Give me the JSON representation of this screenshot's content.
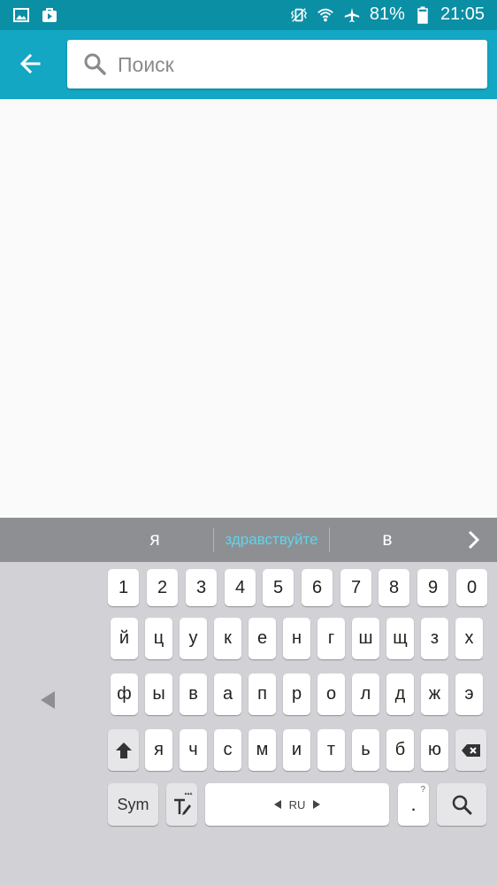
{
  "status_bar": {
    "icons_left": [
      "gallery-icon",
      "play-store-icon"
    ],
    "icons_right": [
      "vibrate-icon",
      "wifi-icon",
      "airplane-icon"
    ],
    "battery_text": "81%",
    "time": "21:05"
  },
  "toolbar": {
    "search_placeholder": "Поиск",
    "accent_color": "#13a7c4"
  },
  "suggestions": {
    "left": "я",
    "middle": "здравствуйте",
    "right": "в"
  },
  "keyboard": {
    "numbers": [
      "1",
      "2",
      "3",
      "4",
      "5",
      "6",
      "7",
      "8",
      "9",
      "0"
    ],
    "row1": [
      "й",
      "ц",
      "у",
      "к",
      "е",
      "н",
      "г",
      "ш",
      "щ",
      "з",
      "х"
    ],
    "row2": [
      "ф",
      "ы",
      "в",
      "а",
      "п",
      "р",
      "о",
      "л",
      "д",
      "ж",
      "э"
    ],
    "row3": [
      "я",
      "ч",
      "с",
      "м",
      "и",
      "т",
      "ь",
      "б",
      "ю"
    ],
    "sym_label": "Sym",
    "space_label": "RU",
    "period_label": ".",
    "period_hint": "?"
  }
}
